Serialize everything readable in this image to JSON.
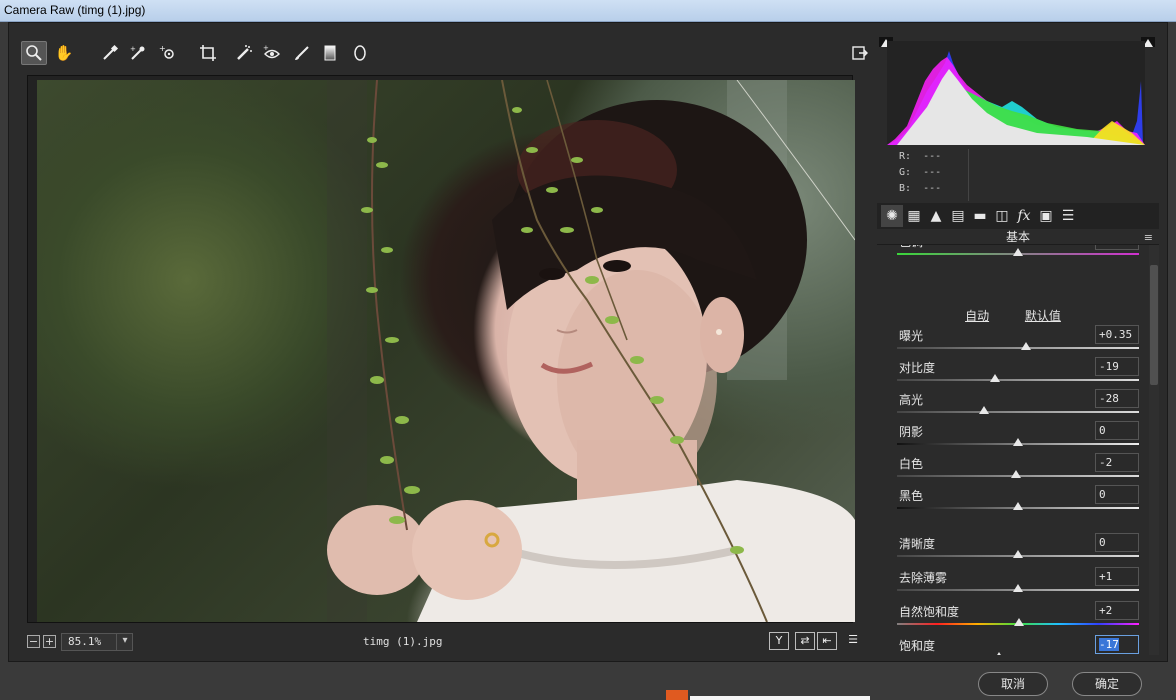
{
  "window": {
    "title": "Camera Raw (timg (1).jpg)"
  },
  "toolbar": {
    "tools": [
      {
        "name": "zoom-tool"
      },
      {
        "name": "hand-tool"
      },
      {
        "name": "white-balance-tool"
      },
      {
        "name": "color-sampler-tool"
      },
      {
        "name": "targeted-adjustment-tool"
      },
      {
        "name": "crop-tool"
      },
      {
        "name": "spot-removal-tool"
      },
      {
        "name": "red-eye-tool"
      },
      {
        "name": "adjustment-brush-tool"
      },
      {
        "name": "graduated-filter-tool"
      },
      {
        "name": "radial-filter-tool"
      }
    ],
    "open_preferences": "open-preferences"
  },
  "statusbar": {
    "minus": "−",
    "plus": "+",
    "zoom": "85.1%",
    "filename": "timg (1).jpg",
    "icon_y": "Y",
    "icon_swap": "⇄",
    "icon_copy": "⇤",
    "icon_settings": "☰"
  },
  "histogram": {
    "r_label": "R:",
    "r_value": "---",
    "g_label": "G:",
    "g_value": "---",
    "b_label": "B:",
    "b_value": "---"
  },
  "panel": {
    "title": "基本",
    "menu": "≡",
    "tint_label": "色调",
    "auto": "自动",
    "default": "默认值",
    "sliders": [
      {
        "label": "曝光",
        "value": "+0.35",
        "pos": 0.535,
        "track": "neutral"
      },
      {
        "label": "对比度",
        "value": "-19",
        "pos": 0.405,
        "track": "neutral"
      },
      {
        "label": "高光",
        "value": "-28",
        "pos": 0.36,
        "track": "neutral"
      },
      {
        "label": "阴影",
        "value": "0",
        "pos": 0.5,
        "track": "dark"
      },
      {
        "label": "白色",
        "value": "-2",
        "pos": 0.49,
        "track": "neutral"
      },
      {
        "label": "黑色",
        "value": "0",
        "pos": 0.5,
        "track": "dark"
      },
      {
        "label": "清晰度",
        "value": "0",
        "pos": 0.5,
        "track": "neutral"
      },
      {
        "label": "去除薄雾",
        "value": "+1",
        "pos": 0.5,
        "track": "neutral"
      },
      {
        "label": "自然饱和度",
        "value": "+2",
        "pos": 0.505,
        "track": "color"
      },
      {
        "label": "饱和度",
        "value": "-17",
        "pos": 0.42,
        "track": "color",
        "selected": true
      }
    ]
  },
  "buttons": {
    "cancel": "取消",
    "ok": "确定"
  }
}
